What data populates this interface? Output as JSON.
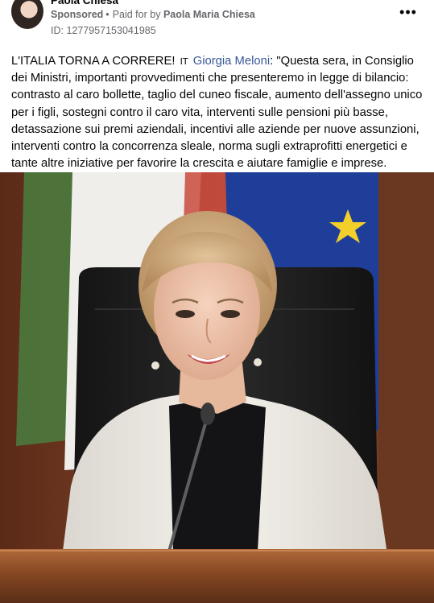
{
  "post": {
    "author": "Paola Chiesa",
    "sponsored_label": "Sponsored",
    "separator": "•",
    "paid_for_prefix": "Paid for by",
    "payer": "Paola Maria Chiesa",
    "ad_id": "ID: 1277957153041985",
    "more_icon": "more-horizontal-icon",
    "text_intro": "L'ITALIA TORNA A CORRERE!",
    "flag_glyph": "IT",
    "mention": "Giorgia Meloni",
    "text_body": ": \"Questa sera, in Consiglio dei Ministri, importanti provvedimenti che presenteremo in legge di bilancio: contrasto al caro bollette, taglio del cuneo fiscale, aumento dell'assegno unico per i figli, sostegni contro il caro vita, interventi sulle pensioni più basse, detassazione sui premi aziendali, incentivi alle aziende per nuove assunzioni, interventi contro la concorrenza sleale, norma sugli extraprofitti energetici e tante altre iniziative per favorire la crescita e aiutare famiglie e imprese. Domani mattina, in conferenza…"
  },
  "colors": {
    "link": "#385898",
    "secondary_text": "#65676b",
    "primary_text": "#050505"
  }
}
